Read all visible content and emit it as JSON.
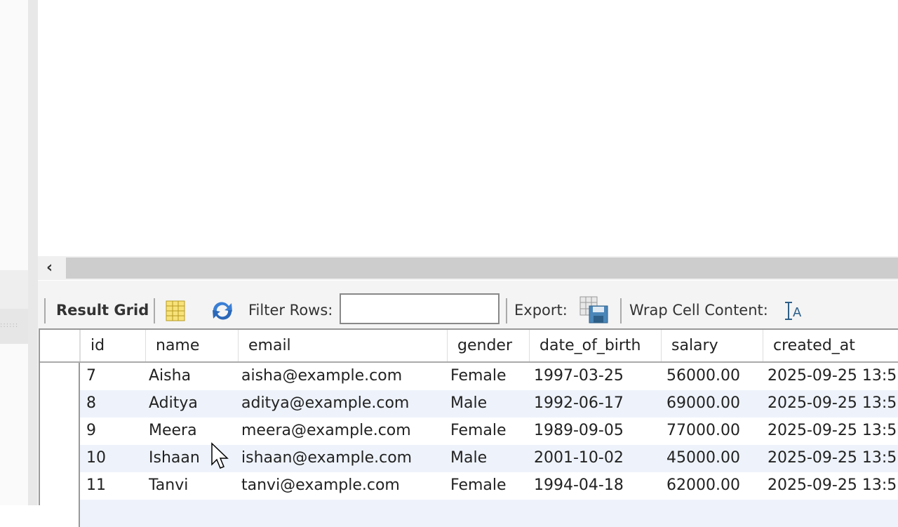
{
  "scrollbar": {
    "left_arrow": "‹"
  },
  "toolbar": {
    "result_grid": "Result Grid",
    "filter_label": "Filter Rows:",
    "filter_value": "",
    "export_label": "Export:",
    "wrap_label": "Wrap Cell Content:"
  },
  "grid": {
    "columns": [
      "id",
      "name",
      "email",
      "gender",
      "date_of_birth",
      "salary",
      "created_at"
    ],
    "rows": [
      [
        "7",
        "Aisha",
        "aisha@example.com",
        "Female",
        "1997-03-25",
        "56000.00",
        "2025-09-25 13:5"
      ],
      [
        "8",
        "Aditya",
        "aditya@example.com",
        "Male",
        "1992-06-17",
        "69000.00",
        "2025-09-25 13:5"
      ],
      [
        "9",
        "Meera",
        "meera@example.com",
        "Female",
        "1989-09-05",
        "77000.00",
        "2025-09-25 13:5"
      ],
      [
        "10",
        "Ishaan",
        "ishaan@example.com",
        "Male",
        "2001-10-02",
        "45000.00",
        "2025-09-25 13:5"
      ],
      [
        "11",
        "Tanvi",
        "tanvi@example.com",
        "Female",
        "1994-04-18",
        "62000.00",
        "2025-09-25 13:5"
      ]
    ]
  }
}
